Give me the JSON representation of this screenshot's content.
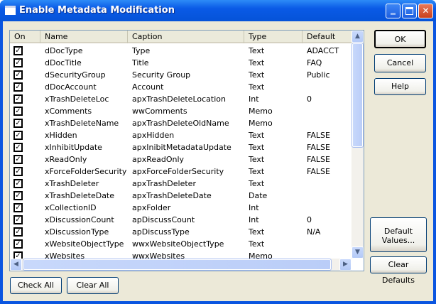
{
  "window": {
    "title": "Enable Metadata Modification"
  },
  "columns": [
    "On",
    "Name",
    "Caption",
    "Type",
    "Default"
  ],
  "rows": [
    {
      "on": true,
      "name": "dDocType",
      "caption": "Type",
      "type": "Text",
      "default": "ADACCT"
    },
    {
      "on": true,
      "name": "dDocTitle",
      "caption": "Title",
      "type": "Text",
      "default": "FAQ"
    },
    {
      "on": true,
      "name": "dSecurityGroup",
      "caption": "Security Group",
      "type": "Text",
      "default": "Public"
    },
    {
      "on": true,
      "name": "dDocAccount",
      "caption": "Account",
      "type": "Text",
      "default": ""
    },
    {
      "on": true,
      "name": "xTrashDeleteLoc",
      "caption": "apxTrashDeleteLocation",
      "type": "Int",
      "default": "0"
    },
    {
      "on": true,
      "name": "xComments",
      "caption": "wwComments",
      "type": "Memo",
      "default": ""
    },
    {
      "on": true,
      "name": "xTrashDeleteName",
      "caption": "apxTrashDeleteOldName",
      "type": "Memo",
      "default": ""
    },
    {
      "on": true,
      "name": "xHidden",
      "caption": "apxHidden",
      "type": "Text",
      "default": "FALSE"
    },
    {
      "on": true,
      "name": "xInhibitUpdate",
      "caption": "apxInibitMetadataUpdate",
      "type": "Text",
      "default": "FALSE"
    },
    {
      "on": true,
      "name": "xReadOnly",
      "caption": "apxReadOnly",
      "type": "Text",
      "default": "FALSE"
    },
    {
      "on": true,
      "name": "xForceFolderSecurity",
      "caption": "apxForceFolderSecurity",
      "type": "Text",
      "default": "FALSE"
    },
    {
      "on": true,
      "name": "xTrashDeleter",
      "caption": "apxTrashDeleter",
      "type": "Text",
      "default": ""
    },
    {
      "on": true,
      "name": "xTrashDeleteDate",
      "caption": "apxTrashDeleteDate",
      "type": "Date",
      "default": ""
    },
    {
      "on": true,
      "name": "xCollectionID",
      "caption": "apxFolder",
      "type": "Int",
      "default": ""
    },
    {
      "on": true,
      "name": "xDiscussionCount",
      "caption": "apDiscussCount",
      "type": "Int",
      "default": "0"
    },
    {
      "on": true,
      "name": "xDiscussionType",
      "caption": "apDiscussType",
      "type": "Text",
      "default": "N/A"
    },
    {
      "on": true,
      "name": "xWebsiteObjectType",
      "caption": "wwxWebsiteObjectType",
      "type": "Text",
      "default": ""
    },
    {
      "on": true,
      "name": "xWebsites",
      "caption": "wwxWebsites",
      "type": "Memo",
      "default": ""
    }
  ],
  "buttons": {
    "ok": "OK",
    "cancel": "Cancel",
    "help": "Help",
    "default_values_1": "Default",
    "default_values_2": "Values...",
    "clear_defaults": "Clear Defaults",
    "check_all": "Check All",
    "clear_all": "Clear All"
  }
}
